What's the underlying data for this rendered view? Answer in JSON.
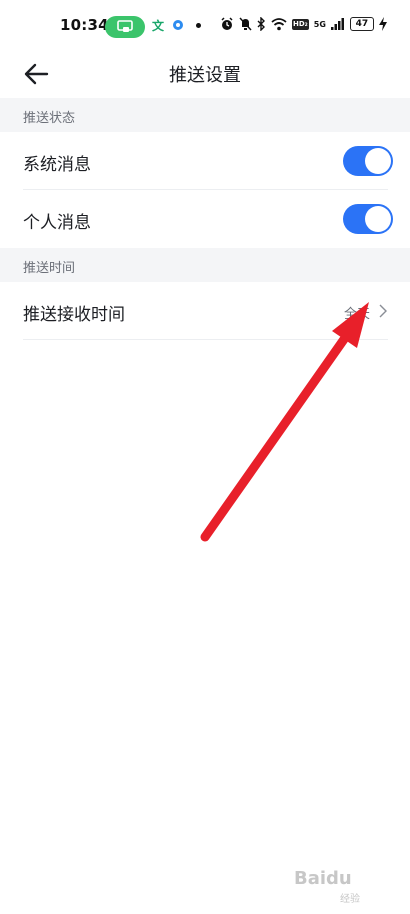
{
  "status_bar": {
    "time": "10:34",
    "app_text": "文",
    "hd_label": "HD₂",
    "network_label": "5G",
    "battery": "47"
  },
  "header": {
    "title": "推送设置"
  },
  "sections": [
    {
      "title": "推送状态",
      "items": [
        {
          "label": "系统消息",
          "toggle_on": true
        },
        {
          "label": "个人消息",
          "toggle_on": true
        }
      ]
    },
    {
      "title": "推送时间",
      "items": [
        {
          "label": "推送接收时间",
          "value": "全天"
        }
      ]
    }
  ],
  "watermark": {
    "text": "Baidu",
    "sub": "经验"
  },
  "colors": {
    "accent": "#2b73f6",
    "annotation_arrow": "#e8202a",
    "cast_pill": "#3bc46b"
  }
}
